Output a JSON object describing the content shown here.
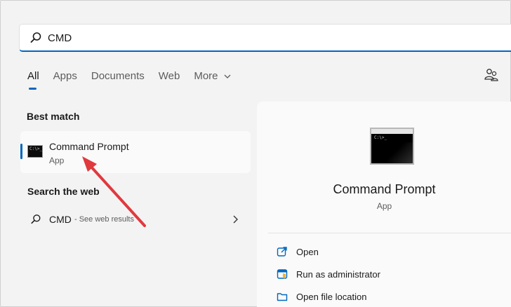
{
  "search": {
    "query": "CMD",
    "icon": "search-icon"
  },
  "tabs": [
    {
      "label": "All"
    },
    {
      "label": "Apps"
    },
    {
      "label": "Documents"
    },
    {
      "label": "Web"
    },
    {
      "label": "More"
    }
  ],
  "best_match": {
    "heading": "Best match",
    "name": "Command Prompt",
    "type": "App",
    "cmd_glyph": "C:\\>_"
  },
  "web": {
    "heading": "Search the web",
    "query": "CMD",
    "hint": " - See web results"
  },
  "detail": {
    "title": "Command Prompt",
    "subtitle": "App",
    "actions": [
      {
        "label": "Open",
        "icon": "open-external-icon"
      },
      {
        "label": "Run as administrator",
        "icon": "shield-admin-icon"
      },
      {
        "label": "Open file location",
        "icon": "folder-icon"
      }
    ]
  },
  "colors": {
    "accent": "#0067c0",
    "arrow": "#e0393e",
    "background": "#f3f3f3"
  }
}
